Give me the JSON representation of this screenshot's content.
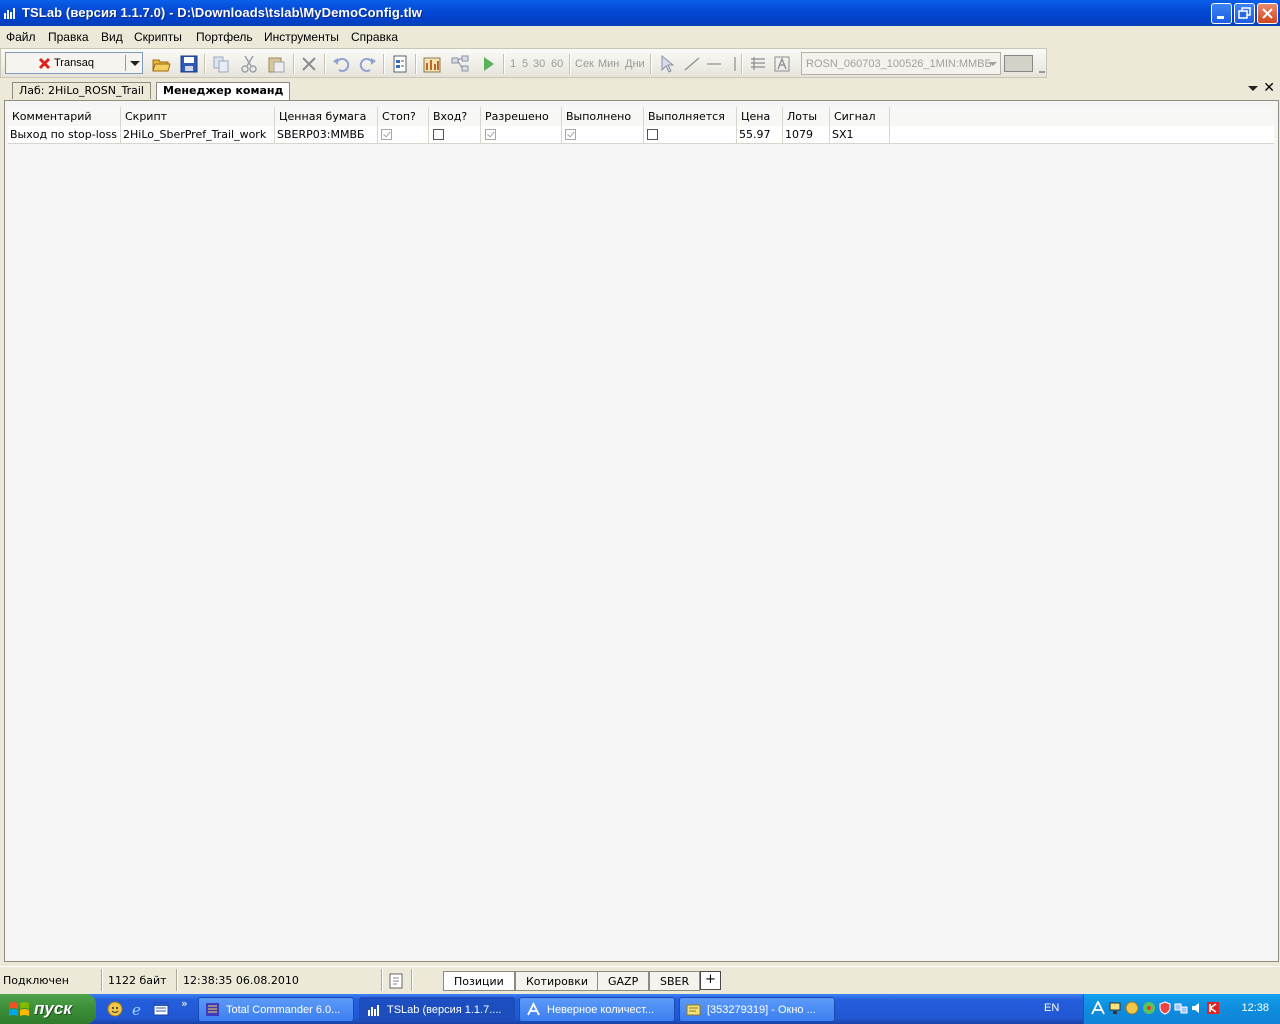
{
  "window": {
    "title": "TSLab (версия 1.1.7.0) - D:\\Downloads\\tslab\\MyDemoConfig.tlw"
  },
  "menu": [
    "Файл",
    "Правка",
    "Вид",
    "Скрипты",
    "Портфель",
    "Инструменты",
    "Справка"
  ],
  "toolbar": {
    "connection_label": "Transaq",
    "intervals": [
      "1",
      "5",
      "30",
      "60",
      "Сек",
      "Мин",
      "Дни"
    ],
    "symbol": "ROSN_060703_100526_1MIN:MMBБ"
  },
  "doc_tabs": [
    "Лаб: 2HiLo_ROSN_Trail",
    "Менеджер команд"
  ],
  "grid": {
    "columns": [
      "Комментарий",
      "Скрипт",
      "Ценная бумага",
      "Стоп?",
      "Вход?",
      "Разрешено",
      "Выполнено",
      "Выполняется",
      "Цена",
      "Лоты",
      "Сигнал"
    ],
    "rows": [
      {
        "comment": "Выход по stop-loss",
        "script": "2HiLo_SberPref_Trail_work",
        "security": "SBERP03:MMBБ",
        "stop": true,
        "entry": false,
        "allowed": true,
        "done": true,
        "executing": false,
        "price": "55.97",
        "lots": "1079",
        "signal": "SX1"
      }
    ]
  },
  "status": {
    "connection": "Подключен",
    "bytes": "1122 байт",
    "datetime": "12:38:35 06.08.2010",
    "tabs": [
      "Позиции",
      "Котировки",
      "GAZP",
      "SBER"
    ],
    "add": "+"
  },
  "taskbar": {
    "start_label": "пуск",
    "chevron": "»",
    "tasks": [
      {
        "label": "Total Commander 6.0..."
      },
      {
        "label": "TSLab (версия 1.1.7...."
      },
      {
        "label": "Неверное количест..."
      },
      {
        "label": "[353279319] - Окно ..."
      }
    ],
    "lang": "EN",
    "clock": "12:38"
  }
}
